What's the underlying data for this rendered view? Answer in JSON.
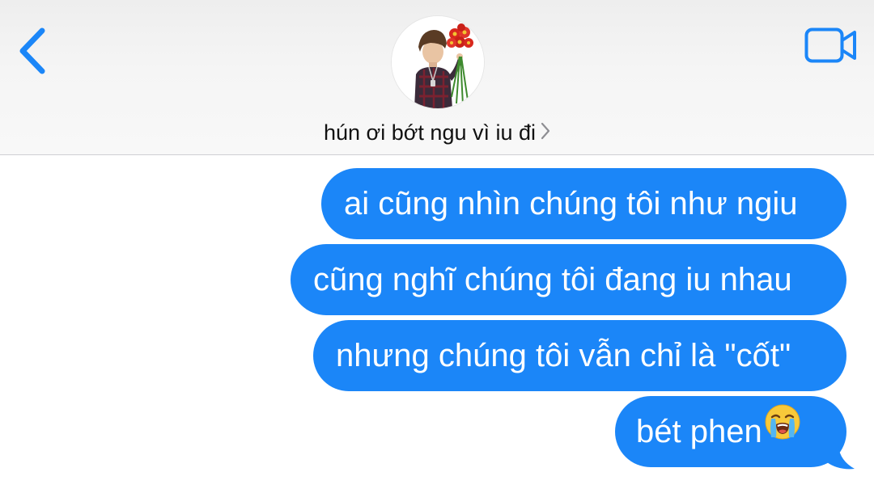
{
  "header": {
    "contact_name": "hún ơi bớt ngu vì iu đi",
    "back_icon": "chevron-left-icon",
    "video_icon": "video-camera-icon",
    "avatar_icon": "contact-avatar"
  },
  "messages": [
    {
      "text": "ai cũng nhìn chúng tôi như ngiu",
      "sender": "me"
    },
    {
      "text": "cũng nghĩ chúng tôi đang iu nhau",
      "sender": "me"
    },
    {
      "text": "nhưng chúng tôi vẫn chỉ là \"cốt\"",
      "sender": "me"
    },
    {
      "text": "bét phen",
      "sender": "me",
      "emoji": "loudly-crying-face-emoji"
    }
  ],
  "colors": {
    "accent": "#1b86f8",
    "bubble_text": "#ffffff",
    "header_bg": "#f5f5f5"
  }
}
